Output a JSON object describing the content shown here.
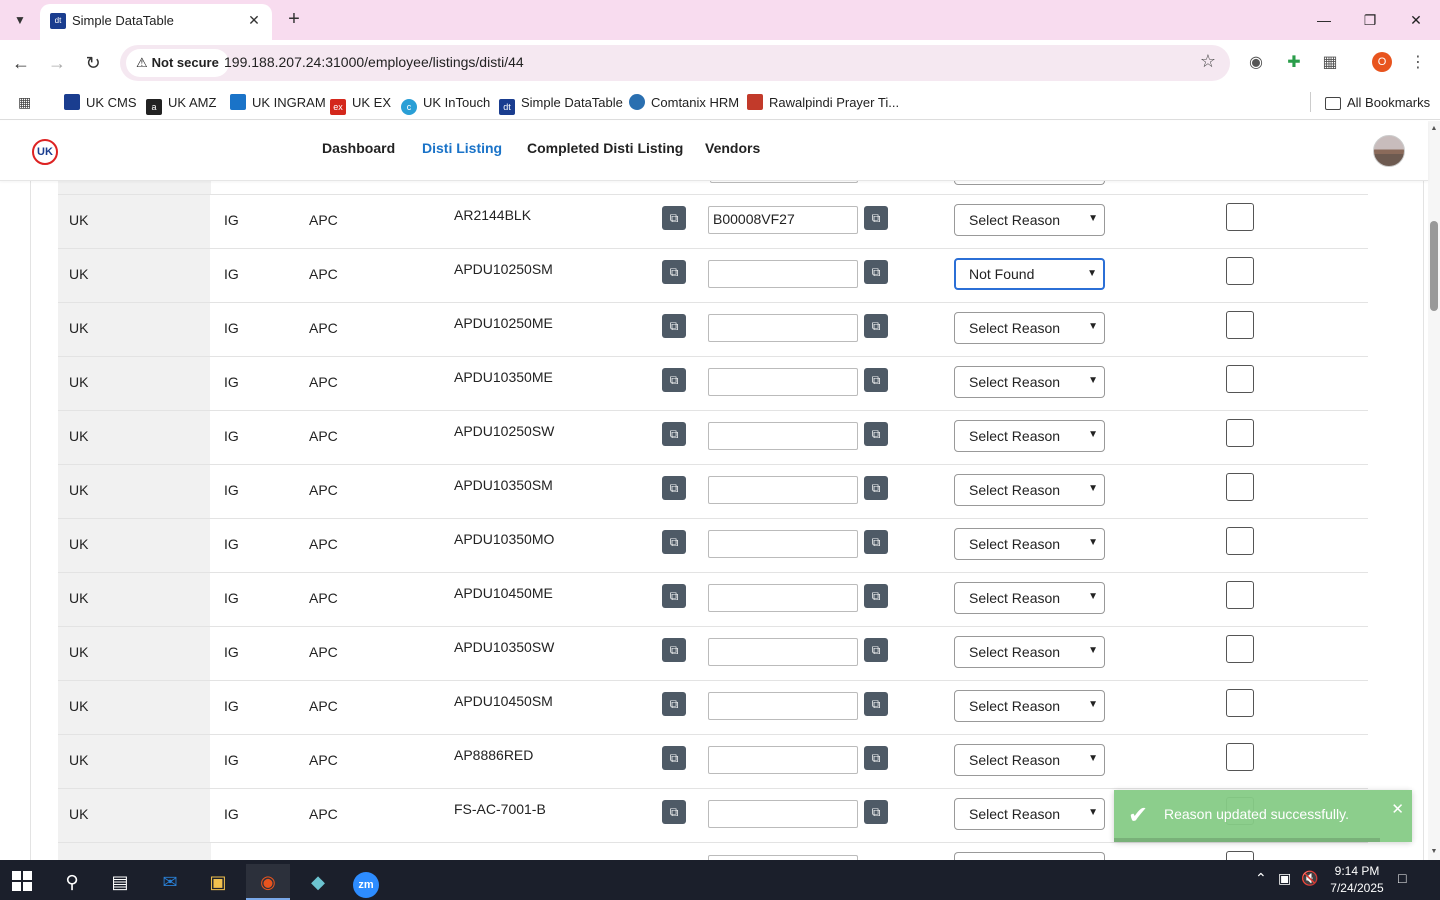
{
  "browser": {
    "tab_title": "Simple DataTable",
    "tab_favicon_text": "dt",
    "security_label": "Not secure",
    "url": "199.188.207.24:31000/employee/listings/disti/44",
    "profile_initial": "O"
  },
  "bookmarks": [
    {
      "label": "UK CMS",
      "color": "#1a3d8f",
      "icon": "cms-icon"
    },
    {
      "label": "UK AMZ",
      "color": "#222222",
      "icon": "amazon-icon"
    },
    {
      "label": "UK INGRAM",
      "color": "#1a73c8",
      "icon": "ingram-icon"
    },
    {
      "label": "UK EX",
      "color": "#d4281c",
      "icon": "ex-icon"
    },
    {
      "label": "UK InTouch",
      "color": "#2a9fd6",
      "icon": "intouch-icon"
    },
    {
      "label": "Simple DataTable",
      "color": "#1a3d8f",
      "icon": "datatable-icon"
    },
    {
      "label": "Comtanix HRM",
      "color": "#2a6fb0",
      "icon": "hrm-icon"
    },
    {
      "label": "Rawalpindi Prayer Ti...",
      "color": "#c23a2a",
      "icon": "prayer-icon"
    }
  ],
  "all_bookmarks_label": "All Bookmarks",
  "app_nav": {
    "logo_text": "UK",
    "links": [
      "Dashboard",
      "Disti Listing",
      "Completed Disti Listing",
      "Vendors"
    ],
    "active_index": 1
  },
  "table": {
    "rows": [
      {
        "region": "UK",
        "distributor": "IG",
        "vendor": "APC",
        "sku": "AR2144BLK",
        "asin": "B00008VF27",
        "reason": "Select Reason",
        "checked": false
      },
      {
        "region": "UK",
        "distributor": "IG",
        "vendor": "APC",
        "sku": "APDU10250SM",
        "asin": "",
        "reason": "Not Found",
        "checked": false
      },
      {
        "region": "UK",
        "distributor": "IG",
        "vendor": "APC",
        "sku": "APDU10250ME",
        "asin": "",
        "reason": "Select Reason",
        "checked": false
      },
      {
        "region": "UK",
        "distributor": "IG",
        "vendor": "APC",
        "sku": "APDU10350ME",
        "asin": "",
        "reason": "Select Reason",
        "checked": false
      },
      {
        "region": "UK",
        "distributor": "IG",
        "vendor": "APC",
        "sku": "APDU10250SW",
        "asin": "",
        "reason": "Select Reason",
        "checked": false
      },
      {
        "region": "UK",
        "distributor": "IG",
        "vendor": "APC",
        "sku": "APDU10350SM",
        "asin": "",
        "reason": "Select Reason",
        "checked": false
      },
      {
        "region": "UK",
        "distributor": "IG",
        "vendor": "APC",
        "sku": "APDU10350MO",
        "asin": "",
        "reason": "Select Reason",
        "checked": false
      },
      {
        "region": "UK",
        "distributor": "IG",
        "vendor": "APC",
        "sku": "APDU10450ME",
        "asin": "",
        "reason": "Select Reason",
        "checked": false
      },
      {
        "region": "UK",
        "distributor": "IG",
        "vendor": "APC",
        "sku": "APDU10350SW",
        "asin": "",
        "reason": "Select Reason",
        "checked": false
      },
      {
        "region": "UK",
        "distributor": "IG",
        "vendor": "APC",
        "sku": "APDU10450SM",
        "asin": "",
        "reason": "Select Reason",
        "checked": false
      },
      {
        "region": "UK",
        "distributor": "IG",
        "vendor": "APC",
        "sku": "AP8886RED",
        "asin": "",
        "reason": "Select Reason",
        "checked": false
      },
      {
        "region": "UK",
        "distributor": "IG",
        "vendor": "APC",
        "sku": "FS-AC-7001-B",
        "asin": "",
        "reason": "Select Reason",
        "checked": false
      }
    ],
    "focused_row_index": 1
  },
  "toast": {
    "message": "Reason updated successfully.",
    "color": "#86cc86"
  },
  "taskbar": {
    "time": "9:14 PM",
    "date": "7/24/2025"
  }
}
